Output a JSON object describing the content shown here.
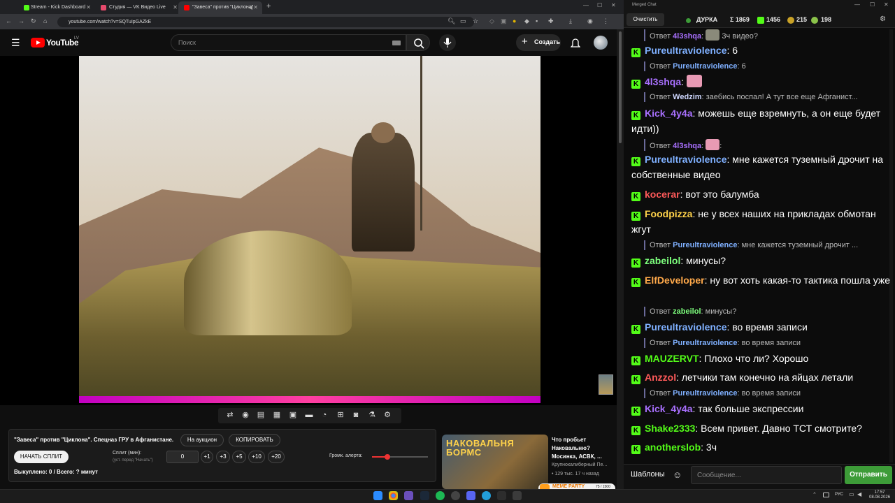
{
  "browser": {
    "tabs": [
      {
        "label": "Stream - Kick Dashboard",
        "color": "#53fc18"
      },
      {
        "label": "Студия — VK Видео Live",
        "color": "#e64a6c"
      },
      {
        "label": "\"Завеса\" против \"Циклона\"",
        "color": "#ff0000"
      }
    ],
    "new_tab": "+",
    "url": "youtube.com/watch?v=SQTuIpGAZkE"
  },
  "youtube": {
    "logo_text": "YouTube",
    "region": "LV",
    "search_placeholder": "Поиск",
    "create_label": "Создать",
    "create_plus": "+"
  },
  "alert_panel": {
    "title": "\"Завеса\" против \"Циклона\". Спецназ ГРУ в Афганистане.",
    "auction_btn": "На аукцион",
    "copy_btn": "КОПИРОВАТЬ",
    "start_split_btn": "НАЧАТЬ СПЛИТ",
    "split_label": "Сплит (мин):",
    "split_hint": "(уст. перед \"Начать\")",
    "split_value": "0",
    "increments": [
      "+1",
      "+3",
      "+5",
      "+10",
      "+20"
    ],
    "volume_label": "Громк. алерта:",
    "volume_level": 0.28,
    "bought_label": "Выкуплено: 0 / Всего: ? минут"
  },
  "recommendation": {
    "title": "Что пробьет Наковальню? Мосинка, АСВК, ...",
    "thumb_text": "НАКОВАЛЬНЯ БОРМС",
    "channel": "Крупнокалиберный Пе...",
    "views": "129 тыс.",
    "age": "17 ч назад",
    "views_age": "• 129 тыс.   17 ч назад",
    "meme_party": "MEME PARTY",
    "meme_progress": "75 / 1500"
  },
  "chat": {
    "window_title": "Merged Chat",
    "clear_btn": "Очистить",
    "channel": "ДУРКА",
    "stats": {
      "sigma": "Σ 1869",
      "kick": "1456",
      "vk": "215",
      "other": "198"
    },
    "messages": [
      {
        "type": "reply",
        "prefix": "Ответ",
        "user": "4l3shqa",
        "user_color": "#a970ff",
        "text": " 3ч видео?",
        "emote": "#8a8a7a"
      },
      {
        "type": "msg",
        "user": "Pureultraviolence",
        "user_color": "#7fb0ff",
        "text": ": 6"
      },
      {
        "type": "reply",
        "prefix": "Ответ",
        "user": "Pureultraviolence",
        "user_color": "#7fb0ff",
        "text": ": 6"
      },
      {
        "type": "msg",
        "user": "4l3shqa",
        "user_color": "#a970ff",
        "text": ":",
        "emote": "#e89ab4"
      },
      {
        "type": "reply",
        "prefix": "Ответ",
        "user": "Wedzim",
        "user_color": "#cfd8ff",
        "text": ": заебись поспал! А тут все еще Афганист..."
      },
      {
        "type": "msg",
        "user": "Kick_4y4a",
        "user_color": "#a970ff",
        "text": ": можешь еще взремнуть, а он еще будет идти))"
      },
      {
        "type": "reply",
        "prefix": "Ответ",
        "user": "4l3shqa",
        "user_color": "#a970ff",
        "text": ":",
        "emote": "#e89ab4"
      },
      {
        "type": "msg",
        "user": "Pureultraviolence",
        "user_color": "#7fb0ff",
        "text": ": мне кажется туземный дрочит на собственные видео"
      },
      {
        "type": "msg",
        "user": "kocerar",
        "user_color": "#ff5a5a",
        "text": ": вот это балумба"
      },
      {
        "type": "msg",
        "user": "Foodpizza",
        "user_color": "#ffd24a",
        "text": ": не у всех наших на прикладах обмотан жгут"
      },
      {
        "type": "reply",
        "prefix": "Ответ",
        "user": "Pureultraviolence",
        "user_color": "#7fb0ff",
        "text": ": мне кажется туземный дрочит ..."
      },
      {
        "type": "msg",
        "user": "zabeilol",
        "user_color": "#7dff7d",
        "text": ": минусы?"
      },
      {
        "type": "msg",
        "user": "ElfDeveloper",
        "user_color": "#ffa94a",
        "text": ": ну вот хоть какая-то тактика пошла уже"
      },
      {
        "type": "reply",
        "prefix": "Ответ",
        "user": "zabeilol",
        "user_color": "#7dff7d",
        "text": ": минусы?"
      },
      {
        "type": "msg",
        "user": "Pureultraviolence",
        "user_color": "#7fb0ff",
        "text": ": во время записи"
      },
      {
        "type": "reply",
        "prefix": "Ответ",
        "user": "Pureultraviolence",
        "user_color": "#7fb0ff",
        "text": ": во время записи"
      },
      {
        "type": "msg",
        "user": "MAUZERVT",
        "user_color": "#53fc18",
        "text": ": Плохо что ли? Хорошо"
      },
      {
        "type": "msg",
        "user": "Anzzol",
        "user_color": "#ff5a5a",
        "text": ": летчики там конечно на яйцах летали"
      },
      {
        "type": "reply",
        "prefix": "Ответ",
        "user": "Pureultraviolence",
        "user_color": "#7fb0ff",
        "text": ": во время записи"
      },
      {
        "type": "msg",
        "user": "Kick_4y4a",
        "user_color": "#a970ff",
        "text": ": так больше экспрессии"
      },
      {
        "type": "msg",
        "user": "Shake2333",
        "user_color": "#53fc18",
        "text": ": Всем привет. Давно ТСТ смотрите?"
      },
      {
        "type": "msg",
        "user": "anotherslob",
        "user_color": "#53fc18",
        "text": ": 3ч"
      }
    ],
    "templates_btn": "Шаблоны",
    "input_placeholder": "Сообщение...",
    "send_btn": "Отправить"
  },
  "taskbar": {
    "lang": "РУС",
    "time": "17:57",
    "date": "08.08.2026"
  },
  "colors": {
    "kick_green": "#53fc18",
    "yt_red": "#ff0000",
    "send_green": "#3d9c38"
  }
}
